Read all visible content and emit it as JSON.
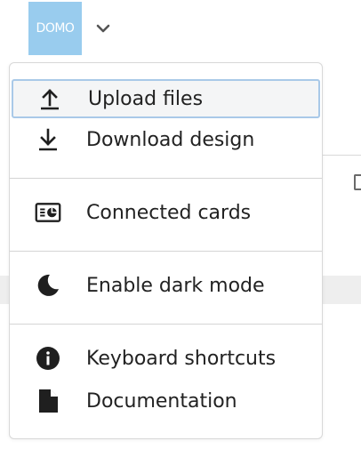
{
  "header": {
    "logo_text": "DOMO",
    "logo_color": "#99ccee",
    "menu_toggle_icon": "chevron-down-icon"
  },
  "menu": {
    "items": [
      {
        "label": "Upload files",
        "icon": "upload-icon",
        "selected": true
      },
      {
        "label": "Download design",
        "icon": "download-icon"
      },
      {
        "label": "Connected cards",
        "icon": "card-chart-icon"
      },
      {
        "label": "Enable dark mode",
        "icon": "moon-icon"
      },
      {
        "label": "Keyboard shortcuts",
        "icon": "info-icon"
      },
      {
        "label": "Documentation",
        "icon": "document-icon"
      }
    ],
    "selected_border_color": "#a9c9e8"
  }
}
